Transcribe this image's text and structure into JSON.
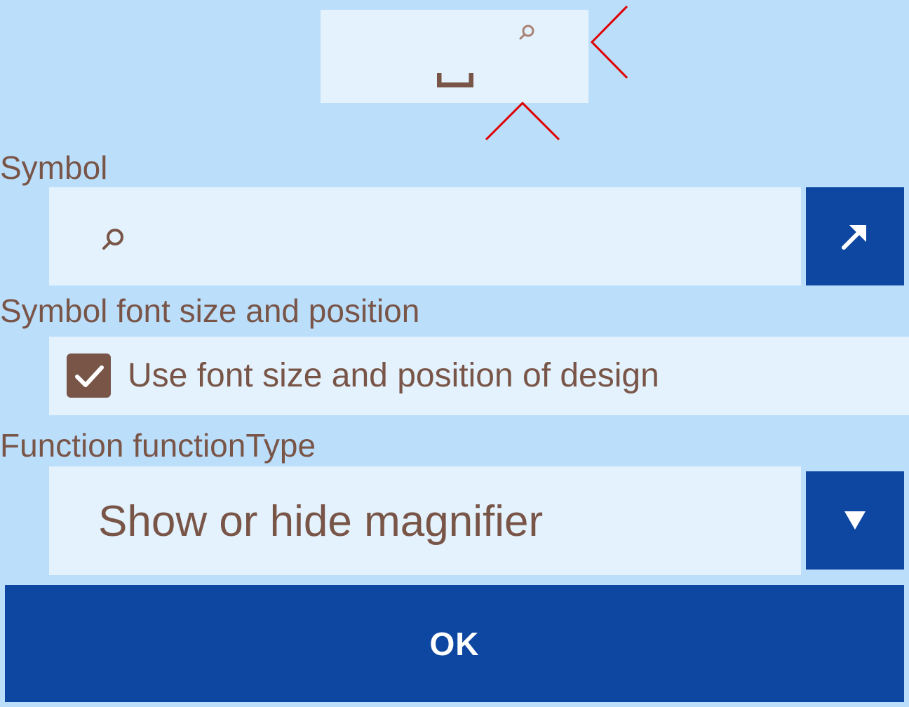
{
  "colors": {
    "background": "#bbdefb",
    "field_background": "#e3f2fd",
    "text": "#795548",
    "button": "#0d47a1",
    "button_text": "#ffffff",
    "marker": "#e00000"
  },
  "key_preview": {
    "symbol_icon": "magnifier-icon",
    "space_glyph": "␣"
  },
  "symbol_section": {
    "label": "Symbol",
    "field_icon": "magnifier-icon",
    "button_icon": "arrow-up-right-icon"
  },
  "font_section": {
    "label": "Symbol font size and position",
    "checkbox_label": "Use font size and position of design",
    "checked": true
  },
  "function_section": {
    "label": "Function functionType",
    "selected_value": "Show or hide magnifier",
    "dropdown_icon": "triangle-down-icon"
  },
  "ok_button": {
    "label": "OK"
  }
}
